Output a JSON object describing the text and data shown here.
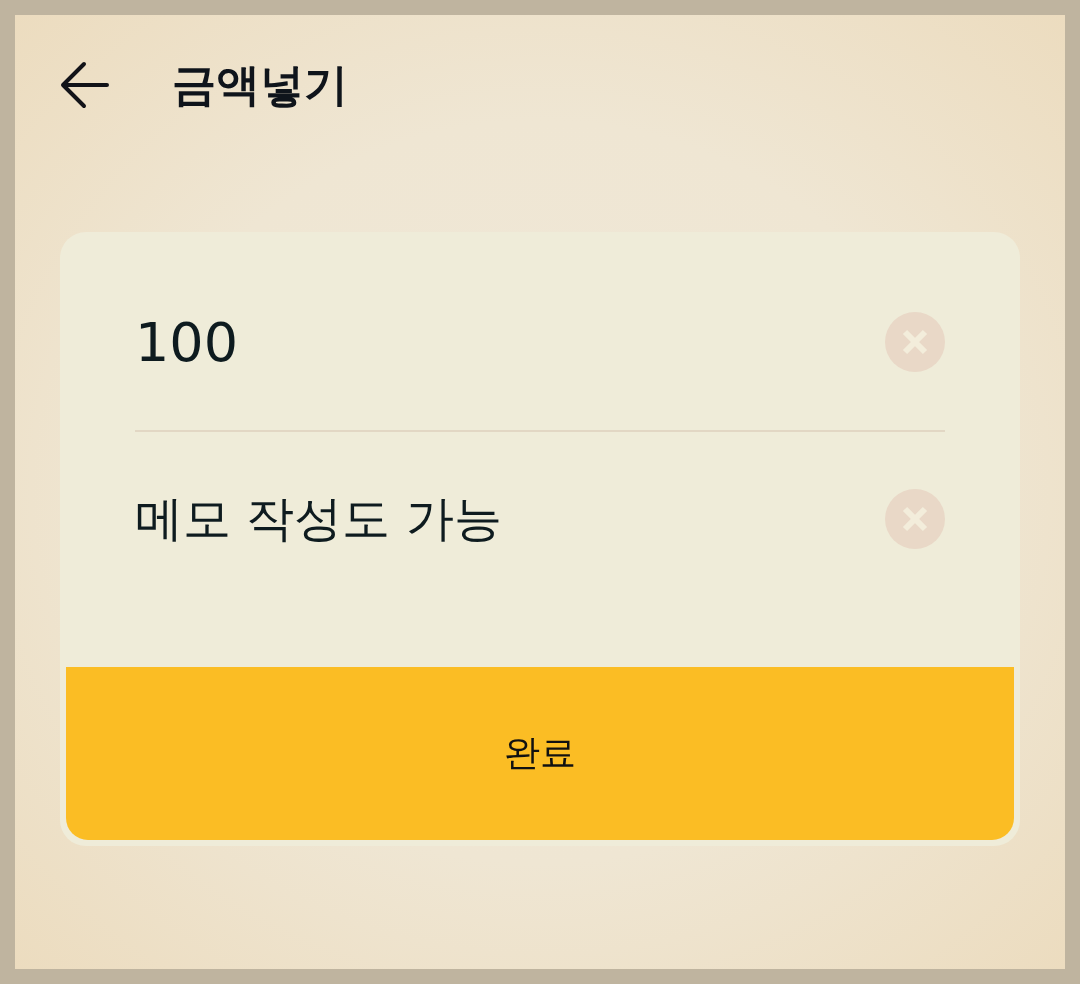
{
  "header": {
    "title": "금액넣기"
  },
  "form": {
    "fields": [
      {
        "kind": "amount",
        "value": "100"
      },
      {
        "kind": "memo",
        "value": "메모 작성도 가능"
      }
    ],
    "submit_button": "완료"
  }
}
